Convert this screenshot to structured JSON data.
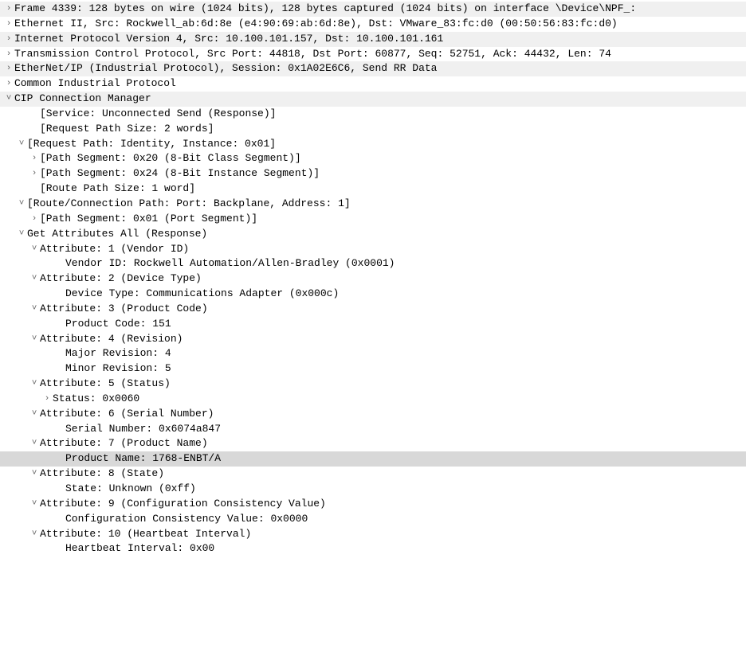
{
  "rows": [
    {
      "arrow": "right",
      "indent": 0,
      "shade": true,
      "text": "Frame 4339: 128 bytes on wire (1024 bits), 128 bytes captured (1024 bits) on interface \\Device\\NPF_:"
    },
    {
      "arrow": "right",
      "indent": 0,
      "shade": false,
      "text": "Ethernet II, Src: Rockwell_ab:6d:8e (e4:90:69:ab:6d:8e), Dst: VMware_83:fc:d0 (00:50:56:83:fc:d0)"
    },
    {
      "arrow": "right",
      "indent": 0,
      "shade": true,
      "text": "Internet Protocol Version 4, Src: 10.100.101.157, Dst: 10.100.101.161"
    },
    {
      "arrow": "right",
      "indent": 0,
      "shade": false,
      "text": "Transmission Control Protocol, Src Port: 44818, Dst Port: 60877, Seq: 52751, Ack: 44432, Len: 74"
    },
    {
      "arrow": "right",
      "indent": 0,
      "shade": true,
      "text": "EtherNet/IP (Industrial Protocol), Session: 0x1A02E6C6, Send RR Data"
    },
    {
      "arrow": "right",
      "indent": 0,
      "shade": false,
      "text": "Common Industrial Protocol"
    },
    {
      "arrow": "down",
      "indent": 0,
      "shade": true,
      "text": "CIP Connection Manager"
    },
    {
      "arrow": "none",
      "indent": 2,
      "shade": false,
      "text": "[Service: Unconnected Send (Response)]"
    },
    {
      "arrow": "none",
      "indent": 2,
      "shade": false,
      "text": "[Request Path Size: 2 words]"
    },
    {
      "arrow": "down",
      "indent": 1,
      "shade": false,
      "text": "[Request Path: Identity, Instance: 0x01]"
    },
    {
      "arrow": "right",
      "indent": 2,
      "shade": false,
      "text": "[Path Segment: 0x20 (8-Bit Class Segment)]"
    },
    {
      "arrow": "right",
      "indent": 2,
      "shade": false,
      "text": "[Path Segment: 0x24 (8-Bit Instance Segment)]"
    },
    {
      "arrow": "none",
      "indent": 2,
      "shade": false,
      "text": "[Route Path Size: 1 word]"
    },
    {
      "arrow": "down",
      "indent": 1,
      "shade": false,
      "text": "[Route/Connection Path: Port: Backplane, Address: 1]"
    },
    {
      "arrow": "right",
      "indent": 2,
      "shade": false,
      "text": "[Path Segment: 0x01 (Port Segment)]"
    },
    {
      "arrow": "down",
      "indent": 1,
      "shade": false,
      "text": "Get Attributes All (Response)"
    },
    {
      "arrow": "down",
      "indent": 2,
      "shade": false,
      "text": "Attribute: 1 (Vendor ID)"
    },
    {
      "arrow": "none",
      "indent": 4,
      "shade": false,
      "text": "Vendor ID: Rockwell Automation/Allen-Bradley (0x0001)"
    },
    {
      "arrow": "down",
      "indent": 2,
      "shade": false,
      "text": "Attribute: 2 (Device Type)"
    },
    {
      "arrow": "none",
      "indent": 4,
      "shade": false,
      "text": "Device Type: Communications Adapter (0x000c)"
    },
    {
      "arrow": "down",
      "indent": 2,
      "shade": false,
      "text": "Attribute: 3 (Product Code)"
    },
    {
      "arrow": "none",
      "indent": 4,
      "shade": false,
      "text": "Product Code: 151"
    },
    {
      "arrow": "down",
      "indent": 2,
      "shade": false,
      "text": "Attribute: 4 (Revision)"
    },
    {
      "arrow": "none",
      "indent": 4,
      "shade": false,
      "text": "Major Revision: 4"
    },
    {
      "arrow": "none",
      "indent": 4,
      "shade": false,
      "text": "Minor Revision: 5"
    },
    {
      "arrow": "down",
      "indent": 2,
      "shade": false,
      "text": "Attribute: 5 (Status)"
    },
    {
      "arrow": "right",
      "indent": 3,
      "shade": false,
      "text": "Status: 0x0060"
    },
    {
      "arrow": "down",
      "indent": 2,
      "shade": false,
      "text": "Attribute: 6 (Serial Number)"
    },
    {
      "arrow": "none",
      "indent": 4,
      "shade": false,
      "text": "Serial Number: 0x6074a847"
    },
    {
      "arrow": "down",
      "indent": 2,
      "shade": false,
      "text": "Attribute: 7 (Product Name)"
    },
    {
      "arrow": "none",
      "indent": 4,
      "shade": false,
      "text": "Product Name: 1768-ENBT/A",
      "selected": true
    },
    {
      "arrow": "down",
      "indent": 2,
      "shade": false,
      "text": "Attribute: 8 (State)"
    },
    {
      "arrow": "none",
      "indent": 4,
      "shade": false,
      "text": "State: Unknown (0xff)"
    },
    {
      "arrow": "down",
      "indent": 2,
      "shade": false,
      "text": "Attribute: 9 (Configuration Consistency Value)"
    },
    {
      "arrow": "none",
      "indent": 4,
      "shade": false,
      "text": "Configuration Consistency Value: 0x0000"
    },
    {
      "arrow": "down",
      "indent": 2,
      "shade": false,
      "text": "Attribute: 10 (Heartbeat Interval)"
    },
    {
      "arrow": "none",
      "indent": 4,
      "shade": false,
      "text": "Heartbeat Interval: 0x00"
    }
  ]
}
